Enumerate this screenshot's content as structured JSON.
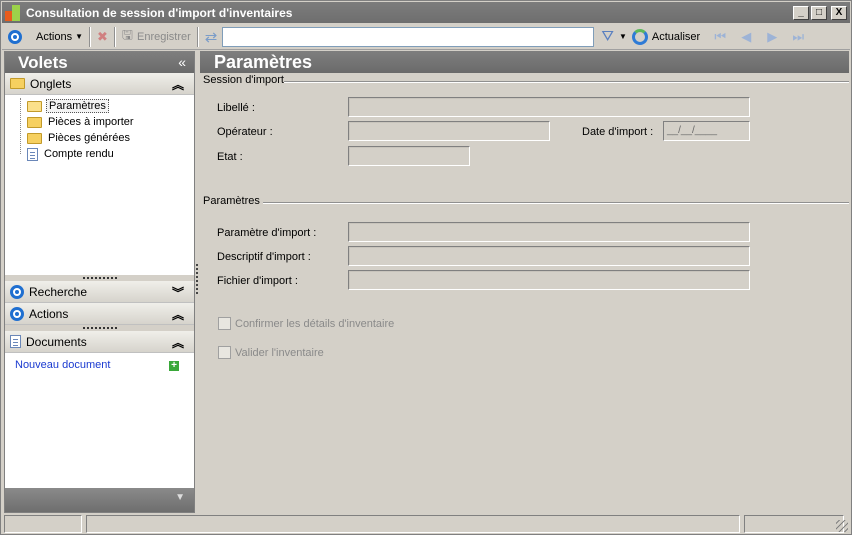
{
  "window": {
    "title": "Consultation de session d'import d'inventaires",
    "controls": {
      "minimize": "_",
      "maximize": "□",
      "close": "X"
    }
  },
  "toolbar": {
    "actions_label": "Actions",
    "save_label": "Enregistrer",
    "search_value": "",
    "refresh_label": "Actualiser",
    "nav": [
      "⏮",
      "◀",
      "▶",
      "⏭"
    ]
  },
  "leftpane": {
    "title": "Volets",
    "collapse_glyph": "«",
    "onglets": {
      "label": "Onglets",
      "items": [
        "Paramètres",
        "Pièces à importer",
        "Pièces générées",
        "Compte rendu"
      ],
      "selected": "Paramètres"
    },
    "recherche": {
      "label": "Recherche"
    },
    "actions": {
      "label": "Actions"
    },
    "documents": {
      "label": "Documents",
      "link": "Nouveau document"
    }
  },
  "main": {
    "title": "Paramètres",
    "session": {
      "title": "Session d'import",
      "libelle_label": "Libellé :",
      "libelle_value": "",
      "operateur_label": "Opérateur :",
      "operateur_value": "",
      "date_label": "Date d'import :",
      "date_value": "__/__/____",
      "etat_label": "Etat :",
      "etat_value": ""
    },
    "params": {
      "title": "Paramètres",
      "param_label": "Paramètre d'import :",
      "param_value": "",
      "descriptif_label": "Descriptif d'import :",
      "descriptif_value": "",
      "fichier_label": "Fichier d'import :",
      "fichier_value": ""
    },
    "checkboxes": {
      "confirmer": "Confirmer les détails d'inventaire",
      "valider": "Valider l'inventaire"
    }
  },
  "colors": {
    "accent_blue": "#1f6fd0",
    "header_grey": "#737373",
    "link_blue": "#1a3ad0"
  }
}
